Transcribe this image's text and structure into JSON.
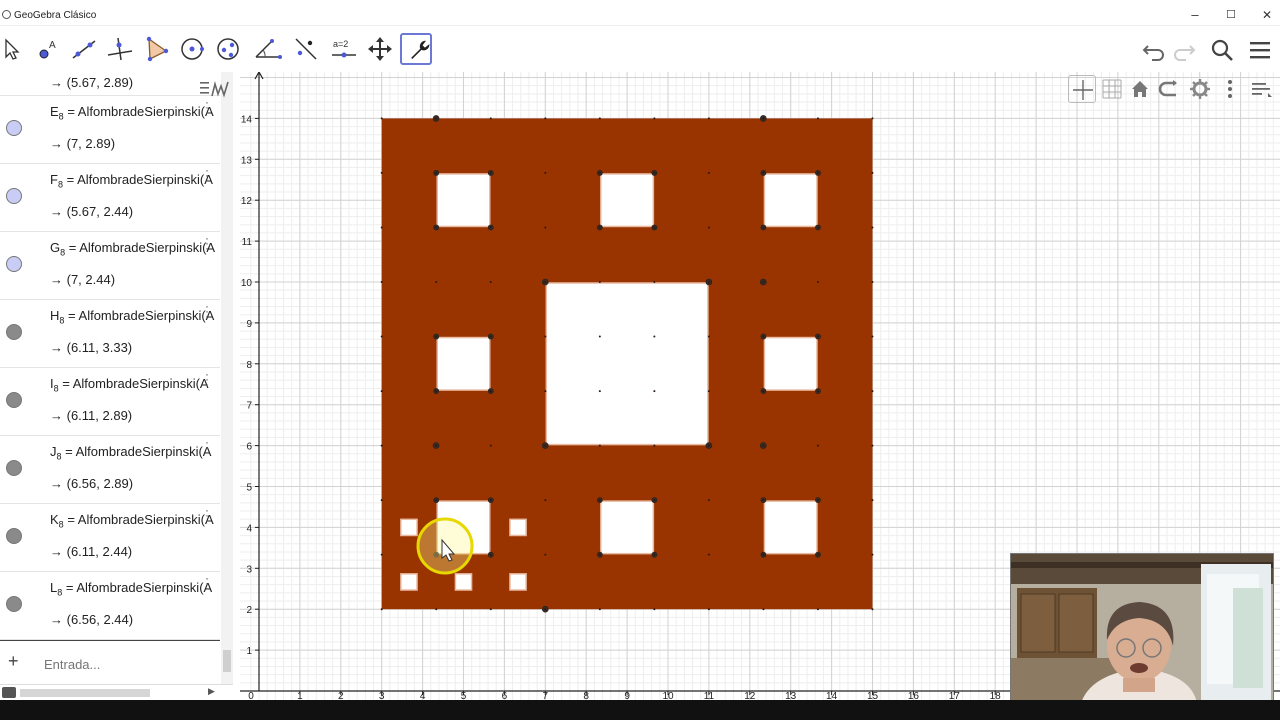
{
  "window": {
    "title": "GeoGebra Clásico",
    "minimize": "–",
    "maximize": "☐",
    "close": "✕"
  },
  "toolbar": {
    "tools": [
      "move-tool",
      "point-tool",
      "line-tool",
      "perpendicular-tool",
      "polygon-tool",
      "circle-tool",
      "conic-tool",
      "angle-tool",
      "reflect-tool",
      "slider-tool",
      "move-graphics-tool",
      "wrench-tool"
    ],
    "slider_label": "a=2",
    "active_tool": "wrench-tool"
  },
  "algebra": {
    "first_value": "→ (5.67, 2.89)",
    "items": [
      {
        "name": "E",
        "sub": "8",
        "definition": "= AlfombradeSierpinski(A",
        "value": "→ (7, 2.89)",
        "color": "#c9cdf5"
      },
      {
        "name": "F",
        "sub": "8",
        "definition": "= AlfombradeSierpinski(A",
        "value": "→ (5.67, 2.44)",
        "color": "#c9cdf5"
      },
      {
        "name": "G",
        "sub": "8",
        "definition": "= AlfombradeSierpinski(A",
        "value": "→ (7, 2.44)",
        "color": "#c9cdf5"
      },
      {
        "name": "H",
        "sub": "8",
        "definition": "= AlfombradeSierpinski(A",
        "value": "→ (6.11, 3.33)",
        "color": "#8a8a8a"
      },
      {
        "name": "I",
        "sub": "8",
        "definition": "= AlfombradeSierpinski(A",
        "value": "→ (6.11, 2.89)",
        "color": "#8a8a8a"
      },
      {
        "name": "J",
        "sub": "8",
        "definition": "= AlfombradeSierpinski(A",
        "value": "→ (6.56, 2.89)",
        "color": "#8a8a8a"
      },
      {
        "name": "K",
        "sub": "8",
        "definition": "= AlfombradeSierpinski(A",
        "value": "→ (6.11, 2.44)",
        "color": "#8a8a8a"
      },
      {
        "name": "L",
        "sub": "8",
        "definition": "= AlfombradeSierpinski(A",
        "value": "→ (6.56, 2.44)",
        "color": "#8a8a8a"
      }
    ],
    "input_placeholder": "Entrada...",
    "input_plus": "+"
  },
  "graphics": {
    "x_axis_labels": [
      "0",
      "1",
      "2",
      "3",
      "4",
      "5",
      "6",
      "7",
      "8",
      "9",
      "10",
      "11",
      "12",
      "13",
      "14",
      "15",
      "16",
      "17",
      "18"
    ],
    "y_axis_labels": [
      "1",
      "2",
      "3",
      "4",
      "5",
      "6",
      "7",
      "8",
      "9",
      "10",
      "11",
      "12",
      "13",
      "14"
    ],
    "carpet_color": "#993300",
    "carpet": {
      "x": [
        3,
        15
      ],
      "y": [
        2,
        14
      ]
    },
    "style_buttons": [
      "axes-icon",
      "grid-icon",
      "home-icon",
      "view-icon",
      "gear-icon",
      "more-icon",
      "style-bar-toggle-icon"
    ]
  },
  "colors": {
    "carpet": "#993300",
    "hole": "#ffffff",
    "active_tool_border": "#6b78d6"
  }
}
